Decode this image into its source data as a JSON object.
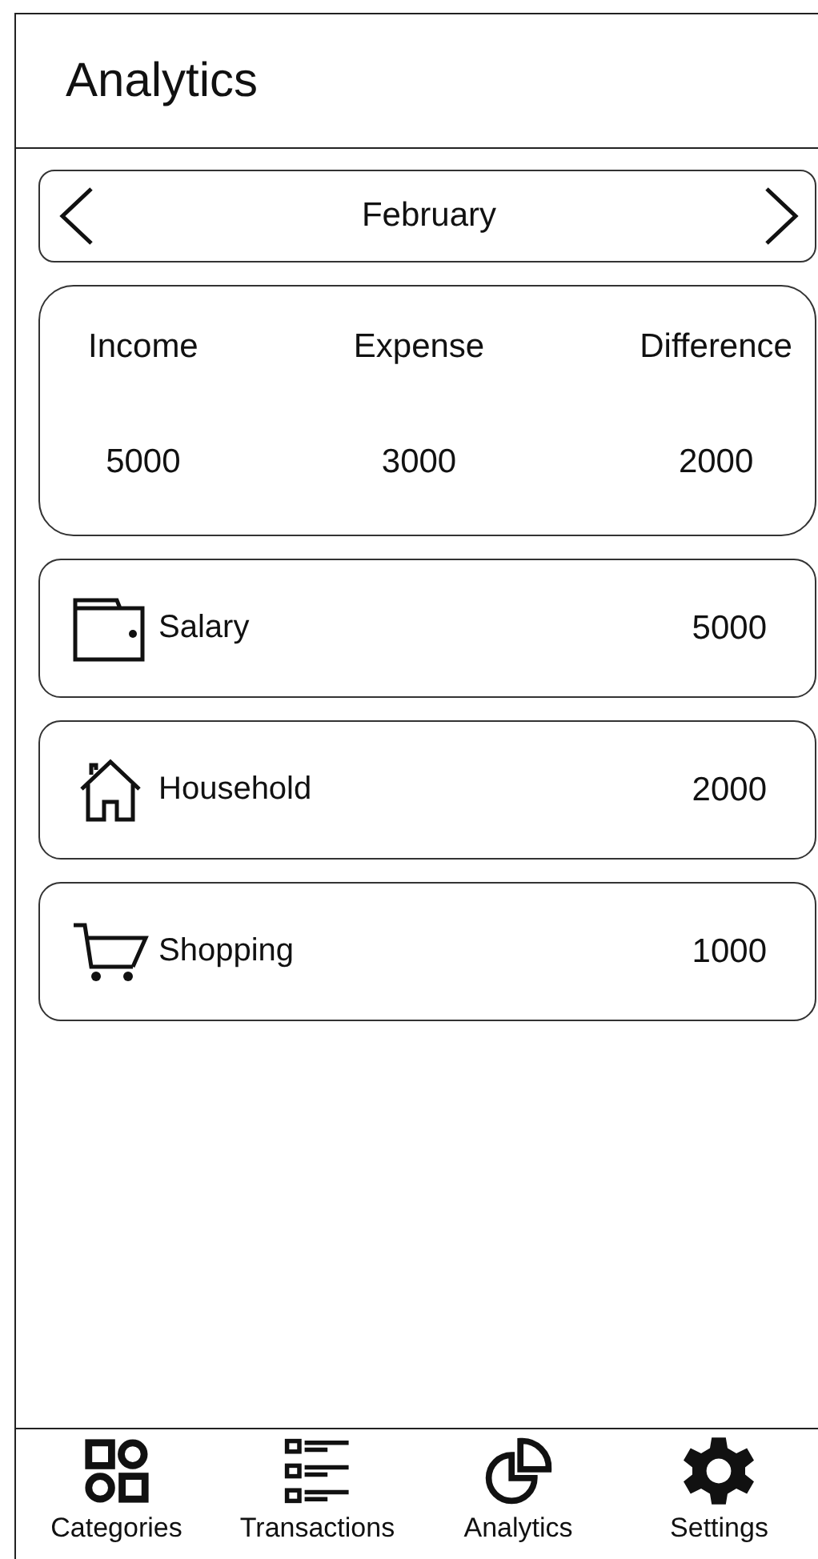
{
  "header": {
    "title": "Analytics"
  },
  "month_selector": {
    "label": "February"
  },
  "summary": [
    {
      "label": "Income",
      "value": "5000"
    },
    {
      "label": "Expense",
      "value": "3000"
    },
    {
      "label": "Difference",
      "value": "2000"
    }
  ],
  "categories": [
    {
      "name": "Salary",
      "amount": "5000"
    },
    {
      "name": "Household",
      "amount": "2000"
    },
    {
      "name": "Shopping",
      "amount": "1000"
    }
  ],
  "bottom_nav": [
    {
      "label": "Categories"
    },
    {
      "label": "Transactions"
    },
    {
      "label": "Analytics"
    },
    {
      "label": "Settings"
    }
  ]
}
